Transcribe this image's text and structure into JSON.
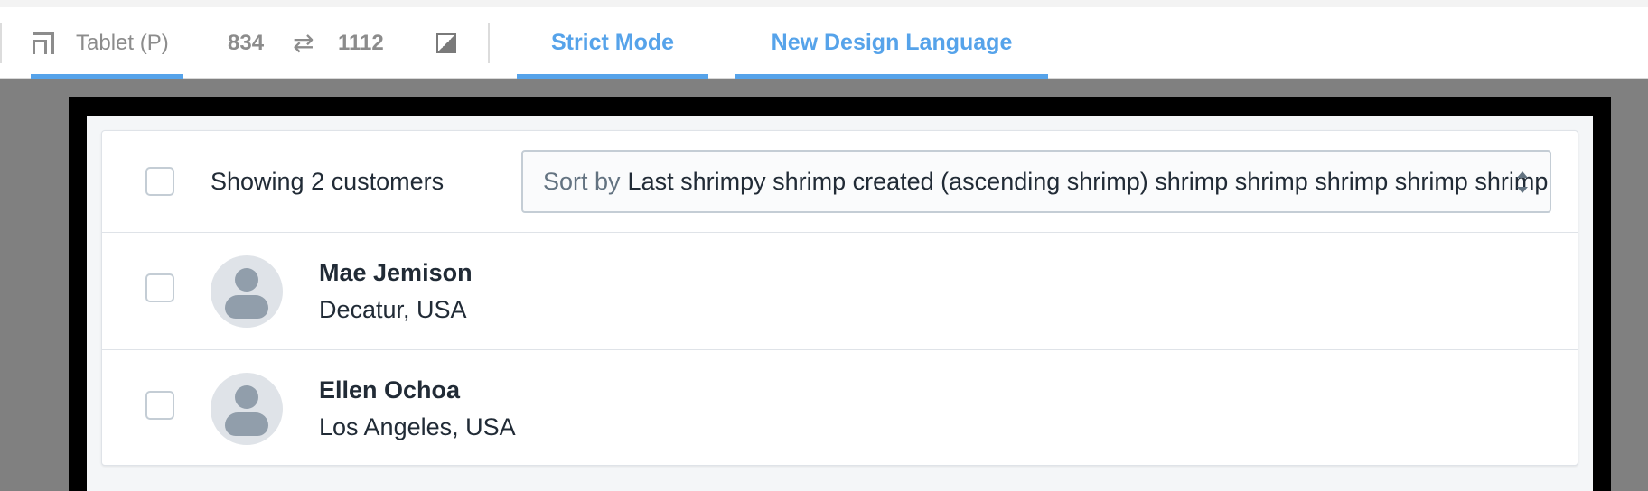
{
  "toolbar": {
    "device_label": "Tablet (P)",
    "width": "834",
    "height": "1112",
    "swap_symbol": "⇄",
    "tabs": [
      {
        "label": "Strict Mode"
      },
      {
        "label": "New Design Language"
      }
    ],
    "accent_color": "#56a3ea"
  },
  "resource_list": {
    "showing_text": "Showing 2 customers",
    "sort": {
      "label": "Sort by",
      "value": "Last shrimpy shrimp created (ascending shrimp) shrimp shrimp shrimp shrimp shrimp"
    },
    "customers": [
      {
        "name": "Mae Jemison",
        "location": "Decatur, USA"
      },
      {
        "name": "Ellen Ochoa",
        "location": "Los Angeles, USA"
      }
    ]
  }
}
